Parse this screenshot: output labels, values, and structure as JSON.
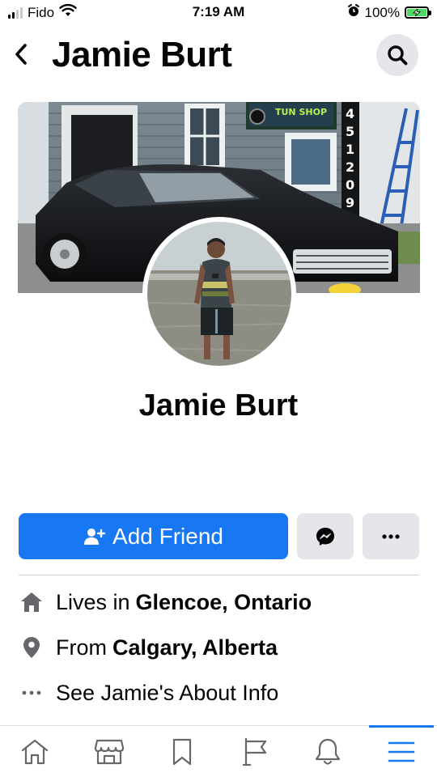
{
  "status_bar": {
    "carrier": "Fido",
    "time": "7:19 AM",
    "battery_percent": "100%",
    "signal_bars_active": 2,
    "signal_bars_total": 4
  },
  "header": {
    "title": "Jamie Burt",
    "back_icon": "chevron-left-icon",
    "search_icon": "search-icon"
  },
  "profile": {
    "name": "Jamie Burt"
  },
  "actions": {
    "add_friend_label": "Add Friend",
    "messenger_icon": "messenger-icon",
    "more_icon": "more-horizontal-icon"
  },
  "intro": {
    "lives_prefix": "Lives in",
    "lives_place": "Glencoe, Ontario",
    "from_prefix": "From",
    "from_place": "Calgary, Alberta",
    "about_label": "See Jamie's About Info"
  },
  "tab_bar": {
    "tabs": [
      {
        "icon": "home-icon"
      },
      {
        "icon": "marketplace-icon"
      },
      {
        "icon": "bookmark-icon"
      },
      {
        "icon": "pages-flag-icon"
      },
      {
        "icon": "bell-icon"
      },
      {
        "icon": "menu-icon",
        "active": true
      }
    ]
  },
  "colors": {
    "accent": "#1877f2",
    "button_gray": "#e4e6eb",
    "text": "#050505",
    "icon_gray": "#65676b"
  }
}
